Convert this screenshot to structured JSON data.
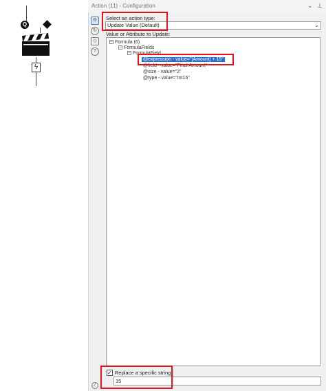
{
  "panel": {
    "title": "Action (11) - Configuration",
    "dropdown_glyph": "⌄",
    "pin_glyph": "⊥"
  },
  "action_type": {
    "label": "Select an action type:",
    "value": "Update Value (Default)"
  },
  "tree": {
    "label": "Value or Attribute to Update:",
    "nodes": [
      {
        "text": "Formula (6)"
      },
      {
        "text": "FormulaFields"
      },
      {
        "text": "FormulaField"
      },
      {
        "text": "@expression - value=\"[Amount] + 15\"",
        "selected": true
      },
      {
        "text": "@field - value=\"Final Amount\""
      },
      {
        "text": "@size - value=\"2\""
      },
      {
        "text": "@type - value=\"Int16\""
      }
    ]
  },
  "replace": {
    "label": "Replace a specific string:",
    "checked": true,
    "value": "15"
  },
  "side_icons": [
    "gear-icon",
    "refresh-icon",
    "tag-icon",
    "help-icon"
  ],
  "colors": {
    "selection": "#2f6fcc",
    "highlight_box": "#e3121b"
  }
}
